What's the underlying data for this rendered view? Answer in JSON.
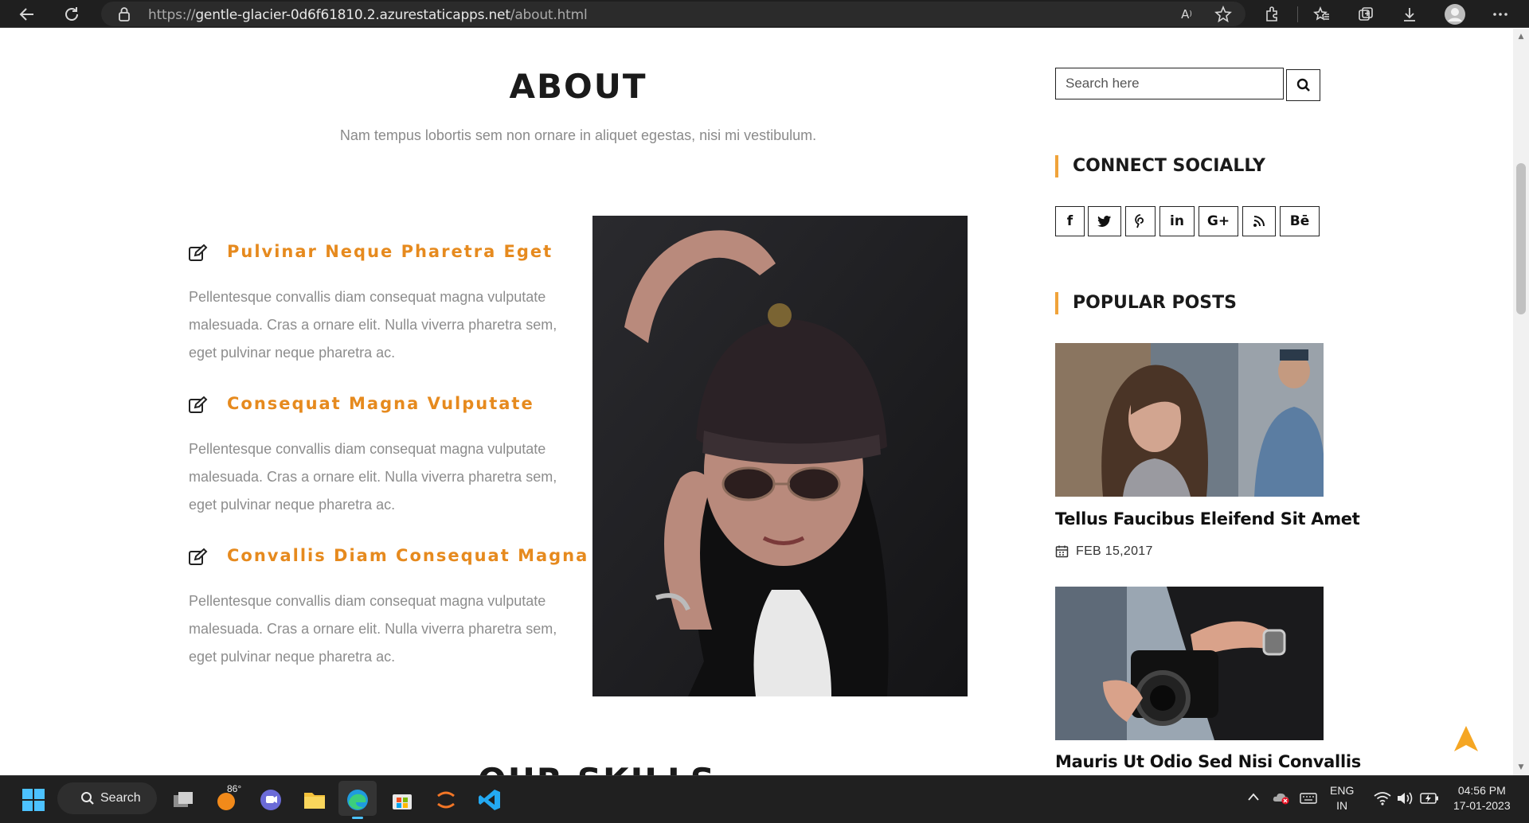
{
  "browser": {
    "url_scheme": "https://",
    "url_host": "gentle-glacier-0d6f61810.2.azurestaticapps.net",
    "url_path": "/about.html"
  },
  "about": {
    "title": "ABOUT",
    "subtitle": "Nam tempus lobortis sem non ornare in aliquet egestas, nisi mi vestibulum."
  },
  "features": [
    {
      "title": "Pulvinar Neque Pharetra Eget",
      "lines": [
        "Pellentesque convallis diam consequat magna vulputate",
        "malesuada. Cras a ornare elit. Nulla viverra pharetra sem,",
        "eget pulvinar neque pharetra ac."
      ]
    },
    {
      "title": "Consequat Magna Vulputate",
      "lines": [
        "Pellentesque convallis diam consequat magna vulputate",
        "malesuada. Cras a ornare elit. Nulla viverra pharetra sem,",
        "eget pulvinar neque pharetra ac."
      ]
    },
    {
      "title": "Convallis Diam Consequat Magna",
      "lines": [
        "Pellentesque convallis diam consequat magna vulputate",
        "malesuada. Cras a ornare elit. Nulla viverra pharetra sem,",
        "eget pulvinar neque pharetra ac."
      ]
    }
  ],
  "skills_title": "OUR SKILLS",
  "sidebar": {
    "search_placeholder": "Search here",
    "connect_heading": "CONNECT SOCIALLY",
    "social": [
      {
        "icon": "facebook-icon",
        "glyph": "f"
      },
      {
        "icon": "twitter-icon",
        "glyph": ""
      },
      {
        "icon": "pinterest-icon",
        "glyph": "P"
      },
      {
        "icon": "linkedin-icon",
        "glyph": "in"
      },
      {
        "icon": "google-plus-icon",
        "glyph": "G+"
      },
      {
        "icon": "rss-icon",
        "glyph": ""
      },
      {
        "icon": "behance-icon",
        "glyph": "Bē"
      }
    ],
    "popular_heading": "POPULAR POSTS",
    "posts": [
      {
        "title": "Tellus Faucibus Eleifend Sit Amet",
        "date": "FEB 15,2017"
      },
      {
        "title": "Mauris Ut Odio Sed Nisi Convallis",
        "date": ""
      }
    ]
  },
  "taskbar": {
    "search_label": "Search",
    "weather": "86°",
    "lang_top": "ENG",
    "lang_bottom": "IN",
    "time": "04:56 PM",
    "date": "17-01-2023"
  },
  "colors": {
    "accent": "#e68a1e",
    "heading_bar": "#f0a33a",
    "scroll_top": "#f5a623"
  }
}
